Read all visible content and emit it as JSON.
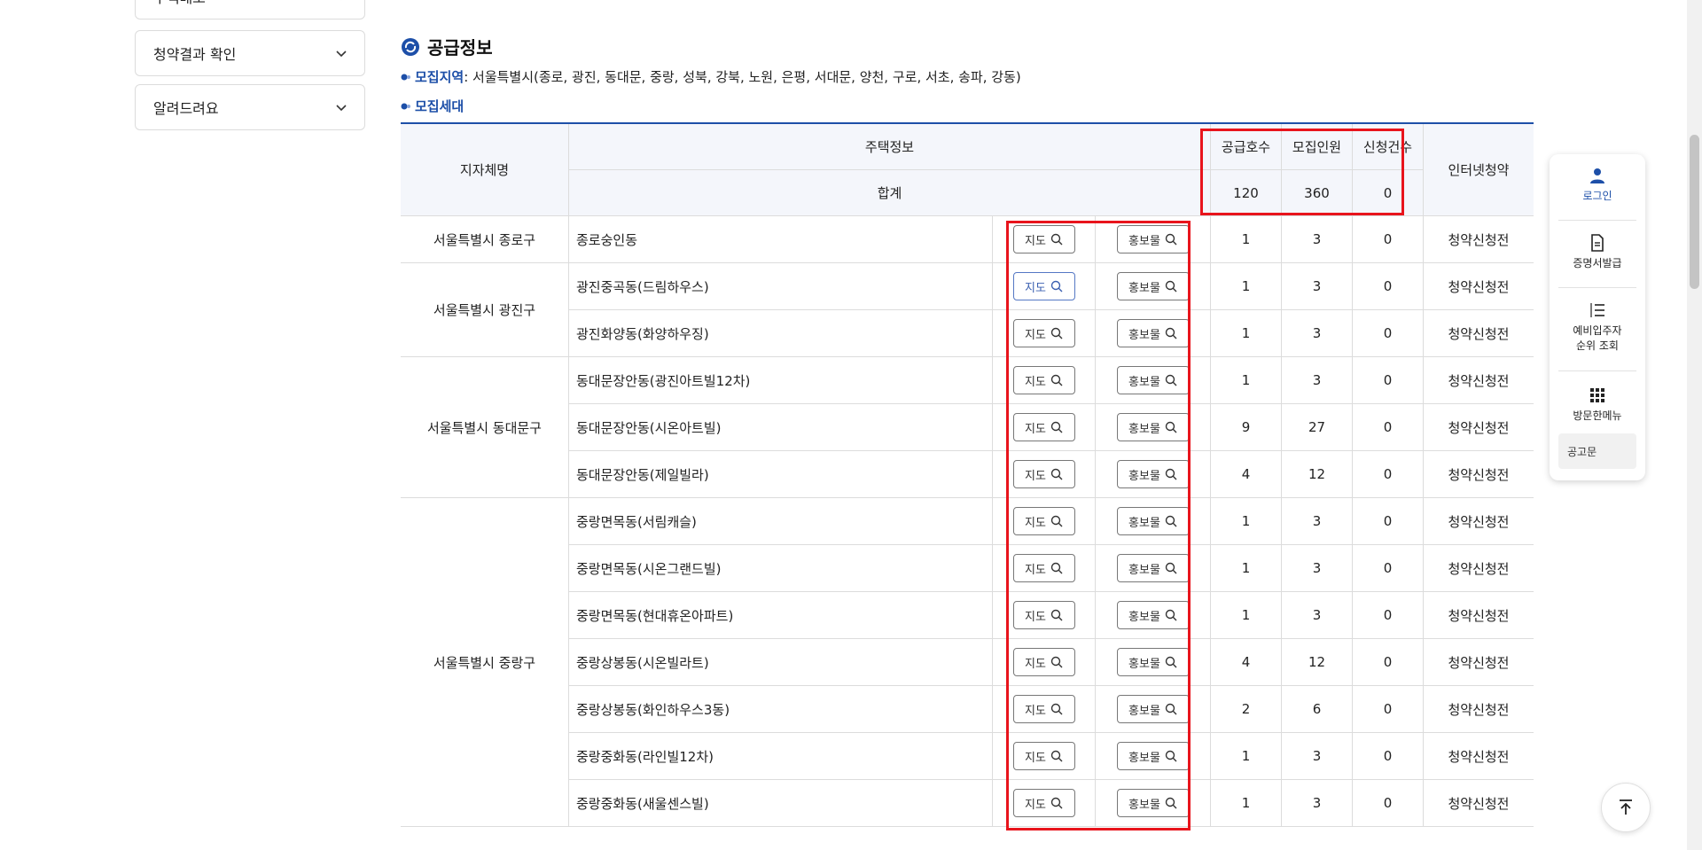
{
  "sidebar": {
    "items": [
      {
        "label": "주택배포"
      },
      {
        "label": "청약결과 확인"
      },
      {
        "label": "알려드려요"
      }
    ]
  },
  "section": {
    "title": "공급정보",
    "region_label": "모집지역",
    "region_value": " : 서울특별시(종로, 광진, 동대문, 중랑, 성북, 강북, 노원, 은평, 서대문, 양천, 구로, 서초, 송파, 강동)",
    "household_label": "모집세대"
  },
  "table": {
    "headers": {
      "region": "지자체명",
      "housing": "주택정보",
      "supply": "공급호수",
      "recruit": "모집인원",
      "applications": "신청건수",
      "internet": "인터넷청약"
    },
    "total": {
      "label": "합계",
      "supply": "120",
      "recruit": "360",
      "applications": "0"
    },
    "map_label": "지도",
    "promo_label": "홍보물",
    "groups": [
      {
        "region": "서울특별시 종로구",
        "rows": [
          {
            "name": "종로숭인동",
            "supply": "1",
            "recruit": "3",
            "applications": "0",
            "status": "청약신청전"
          }
        ]
      },
      {
        "region": "서울특별시 광진구",
        "rows": [
          {
            "name": "광진중곡동(드림하우스)",
            "supply": "1",
            "recruit": "3",
            "applications": "0",
            "status": "청약신청전"
          },
          {
            "name": "광진화양동(화양하우징)",
            "supply": "1",
            "recruit": "3",
            "applications": "0",
            "status": "청약신청전"
          }
        ]
      },
      {
        "region": "서울특별시 동대문구",
        "rows": [
          {
            "name": "동대문장안동(광진아트빌12차)",
            "supply": "1",
            "recruit": "3",
            "applications": "0",
            "status": "청약신청전"
          },
          {
            "name": "동대문장안동(시온아트빌)",
            "supply": "9",
            "recruit": "27",
            "applications": "0",
            "status": "청약신청전"
          },
          {
            "name": "동대문장안동(제일빌라)",
            "supply": "4",
            "recruit": "12",
            "applications": "0",
            "status": "청약신청전"
          }
        ]
      },
      {
        "region": "서울특별시 중랑구",
        "rows": [
          {
            "name": "중랑면목동(서림캐슬)",
            "supply": "1",
            "recruit": "3",
            "applications": "0",
            "status": "청약신청전"
          },
          {
            "name": "중랑면목동(시온그랜드빌)",
            "supply": "1",
            "recruit": "3",
            "applications": "0",
            "status": "청약신청전"
          },
          {
            "name": "중랑면목동(현대휴온아파트)",
            "supply": "1",
            "recruit": "3",
            "applications": "0",
            "status": "청약신청전"
          },
          {
            "name": "중랑상봉동(시온빌라트)",
            "supply": "4",
            "recruit": "12",
            "applications": "0",
            "status": "청약신청전"
          },
          {
            "name": "중랑상봉동(화인하우스3동)",
            "supply": "2",
            "recruit": "6",
            "applications": "0",
            "status": "청약신청전"
          },
          {
            "name": "중랑중화동(라인빌12차)",
            "supply": "1",
            "recruit": "3",
            "applications": "0",
            "status": "청약신청전"
          },
          {
            "name": "중랑중화동(새울센스빌)",
            "supply": "1",
            "recruit": "3",
            "applications": "0",
            "status": "청약신청전"
          }
        ]
      }
    ]
  },
  "float_menu": {
    "login": "로그인",
    "certificate": "증명서발급",
    "ranking_line1": "예비입주자",
    "ranking_line2": "순위 조회",
    "visited": "방문한메뉴",
    "notice": "공고문"
  },
  "icons": {
    "accent": "#1d4fa8",
    "highlight": "#e8141c"
  }
}
